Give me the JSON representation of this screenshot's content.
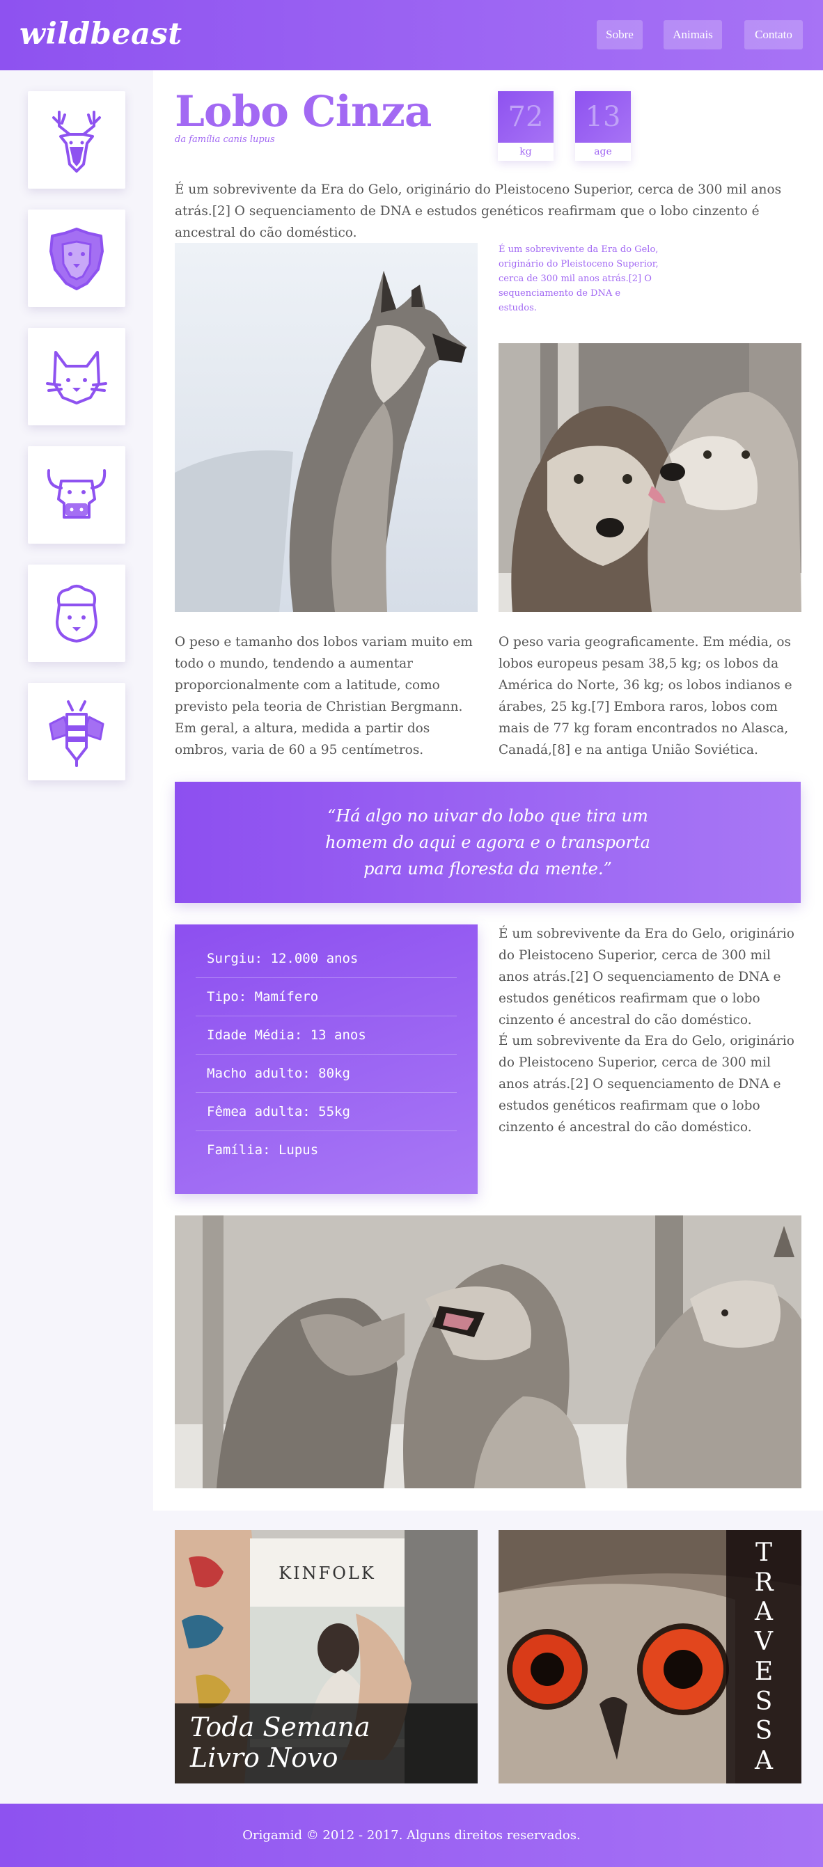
{
  "header": {
    "logo": "wildbeast",
    "nav": [
      {
        "label": "Sobre"
      },
      {
        "label": "Animais"
      },
      {
        "label": "Contato"
      }
    ]
  },
  "sidebar": {
    "items": [
      {
        "icon": "deer-icon"
      },
      {
        "icon": "lion-icon"
      },
      {
        "icon": "fox-icon"
      },
      {
        "icon": "bull-icon"
      },
      {
        "icon": "sheep-icon"
      },
      {
        "icon": "bee-icon"
      }
    ]
  },
  "animal": {
    "title": "Lobo Cinza",
    "subtitle": "da família canis lupus",
    "stats": [
      {
        "value": "72",
        "label": "kg"
      },
      {
        "value": "13",
        "label": "age"
      }
    ],
    "intro": "É um sobrevivente da Era do Gelo, originário do Pleistoceno Superior, cerca de 300 mil anos atrás.[2] O sequenciamento de DNA e estudos genéticos reafirmam que o lobo cinzento é ancestral do cão doméstico.",
    "caption": "É um sobrevivente da Era do Gelo, originário do Pleistoceno Superior, cerca de 300 mil anos atrás.[2] O sequenciamento de DNA e estudos.",
    "para_left": "O peso e tamanho dos lobos variam muito em todo o mundo, tendendo a aumentar proporcionalmente com a latitude, como previsto pela teoria de Christian Bergmann. Em geral, a altura, medida a partir dos ombros, varia de 60 a 95 centímetros.",
    "para_right": "O peso varia geograficamente. Em média, os lobos europeus pesam 38,5 kg; os lobos da América do Norte, 36 kg; os lobos indianos e árabes, 25 kg.[7] Embora raros, lobos com mais de 77 kg foram encontrados no Alasca, Canadá,[8] e na antiga União Soviética.",
    "quote": "“Há algo no uivar do lobo que tira um homem do aqui e agora e o transporta para uma floresta da mente.”",
    "facts": [
      "Surgiu: 12.000 anos",
      "Tipo: Mamífero",
      "Idade Média: 13 anos",
      "Macho adulto: 80kg",
      "Fêmea adulta: 55kg",
      "Família: Lupus"
    ],
    "facts_text_1": "É um sobrevivente da Era do Gelo, originário do Pleistoceno Superior, cerca de 300 mil anos atrás.[2] O sequenciamento de DNA e estudos genéticos reafirmam que o lobo cinzento é ancestral do cão doméstico.",
    "facts_text_2": "É um sobrevivente da Era do Gelo, originário do Pleistoceno Superior, cerca de 300 mil anos atrás.[2] O sequenciamento de DNA e estudos genéticos reafirmam que o lobo cinzento é ancestral do cão doméstico."
  },
  "promos": {
    "left_label_line1": "Toda Semana",
    "left_label_line2": "Livro Novo",
    "magazine_title": "KINFOLK",
    "right_letters": [
      "T",
      "R",
      "A",
      "V",
      "E",
      "S",
      "S",
      "A"
    ]
  },
  "footer": {
    "text": "Origamid © 2012 - 2017. Alguns direitos reservados."
  },
  "colors": {
    "accent": "#a269f3",
    "gradient_start": "#8e52f0",
    "gradient_end": "#a773f5"
  }
}
